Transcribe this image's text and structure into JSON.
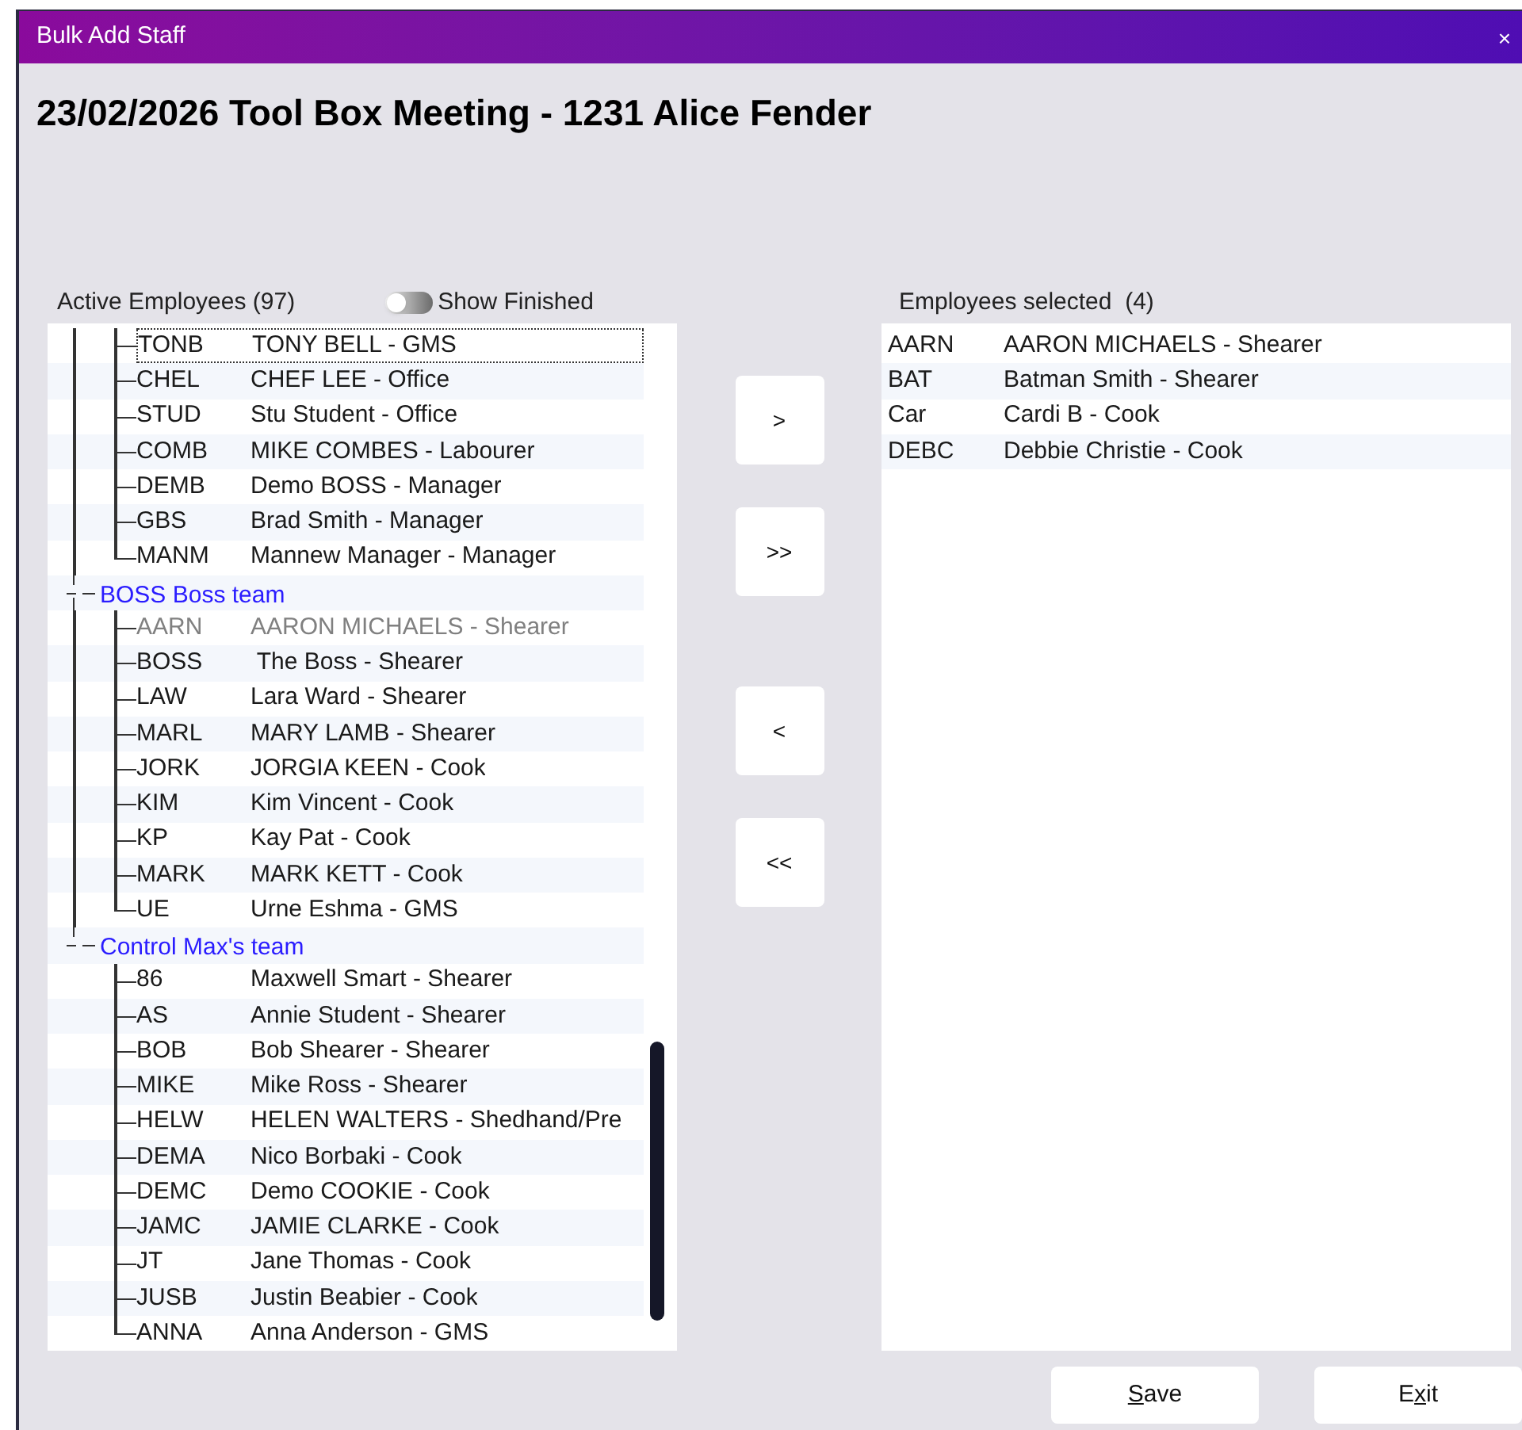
{
  "window": {
    "title": "Bulk Add Staff",
    "close": "×"
  },
  "heading": "23/02/2026 Tool Box Meeting - 1231 Alice Fender",
  "active_employees": {
    "label": "Active Employees (97)",
    "show_finished": {
      "label": "Show Finished",
      "on": false
    },
    "groups": [
      {
        "children": [
          {
            "code": "TONB",
            "name": "TONY BELL - GMS",
            "disabled": false,
            "focused": true
          },
          {
            "code": "CHEL",
            "name": "CHEF LEE - Office",
            "disabled": false,
            "focused": false
          },
          {
            "code": "STUD",
            "name": "Stu Student - Office",
            "disabled": false,
            "focused": false
          },
          {
            "code": "COMB",
            "name": "MIKE COMBES - Labourer",
            "disabled": false,
            "focused": false
          },
          {
            "code": "DEMB",
            "name": "Demo BOSS - Manager",
            "disabled": false,
            "focused": false
          },
          {
            "code": "GBS",
            "name": "Brad Smith - Manager",
            "disabled": false,
            "focused": false
          },
          {
            "code": "MANM",
            "name": "Mannew Manager - Manager",
            "disabled": false,
            "focused": false
          }
        ]
      },
      {
        "label": "BOSS Boss team",
        "children": [
          {
            "code": "AARN",
            "name": "AARON MICHAELS - Shearer",
            "disabled": true,
            "focused": false
          },
          {
            "code": "BOSS",
            "name": " The Boss - Shearer",
            "disabled": false,
            "focused": false
          },
          {
            "code": "LAW",
            "name": "Lara Ward - Shearer",
            "disabled": false,
            "focused": false
          },
          {
            "code": "MARL",
            "name": "MARY LAMB - Shearer",
            "disabled": false,
            "focused": false
          },
          {
            "code": "JORK",
            "name": "JORGIA KEEN - Cook",
            "disabled": false,
            "focused": false
          },
          {
            "code": "KIM",
            "name": "Kim Vincent - Cook",
            "disabled": false,
            "focused": false
          },
          {
            "code": "KP",
            "name": "Kay Pat - Cook",
            "disabled": false,
            "focused": false
          },
          {
            "code": "MARK",
            "name": "MARK KETT - Cook",
            "disabled": false,
            "focused": false
          },
          {
            "code": "UE",
            "name": "Urne Eshma - GMS",
            "disabled": false,
            "focused": false
          }
        ]
      },
      {
        "label": "Control Max's team",
        "children": [
          {
            "code": "86",
            "name": "Maxwell Smart - Shearer",
            "disabled": false,
            "focused": false
          },
          {
            "code": "AS",
            "name": "Annie Student - Shearer",
            "disabled": false,
            "focused": false
          },
          {
            "code": "BOB",
            "name": "Bob Shearer - Shearer",
            "disabled": false,
            "focused": false
          },
          {
            "code": "MIKE",
            "name": "Mike Ross - Shearer",
            "disabled": false,
            "focused": false
          },
          {
            "code": "HELW",
            "name": "HELEN WALTERS - Shedhand/Pre",
            "disabled": false,
            "focused": false
          },
          {
            "code": "DEMA",
            "name": "Nico Borbaki - Cook",
            "disabled": false,
            "focused": false
          },
          {
            "code": "DEMC",
            "name": "Demo COOKIE - Cook",
            "disabled": false,
            "focused": false
          },
          {
            "code": "JAMC",
            "name": "JAMIE CLARKE - Cook",
            "disabled": false,
            "focused": false
          },
          {
            "code": "JT",
            "name": "Jane Thomas - Cook",
            "disabled": false,
            "focused": false
          },
          {
            "code": "JUSB",
            "name": "Justin Beabier - Cook",
            "disabled": false,
            "focused": false
          },
          {
            "code": "ANNA",
            "name": "Anna Anderson - GMS",
            "disabled": false,
            "focused": false
          }
        ]
      }
    ]
  },
  "move_buttons": [
    ">",
    ">>",
    "<",
    "<<"
  ],
  "employees_selected": {
    "label": "Employees selected  (4)",
    "rows": [
      {
        "code": "AARN",
        "name": "AARON MICHAELS - Shearer"
      },
      {
        "code": "BAT",
        "name": "Batman Smith - Shearer"
      },
      {
        "code": "Car",
        "name": "Cardi B - Cook"
      },
      {
        "code": "DEBC",
        "name": "Debbie Christie - Cook"
      }
    ]
  },
  "buttons": [
    {
      "access_key": "S",
      "after": "ave"
    },
    {
      "before": "E",
      "access_key": "x",
      "after": "it"
    }
  ]
}
